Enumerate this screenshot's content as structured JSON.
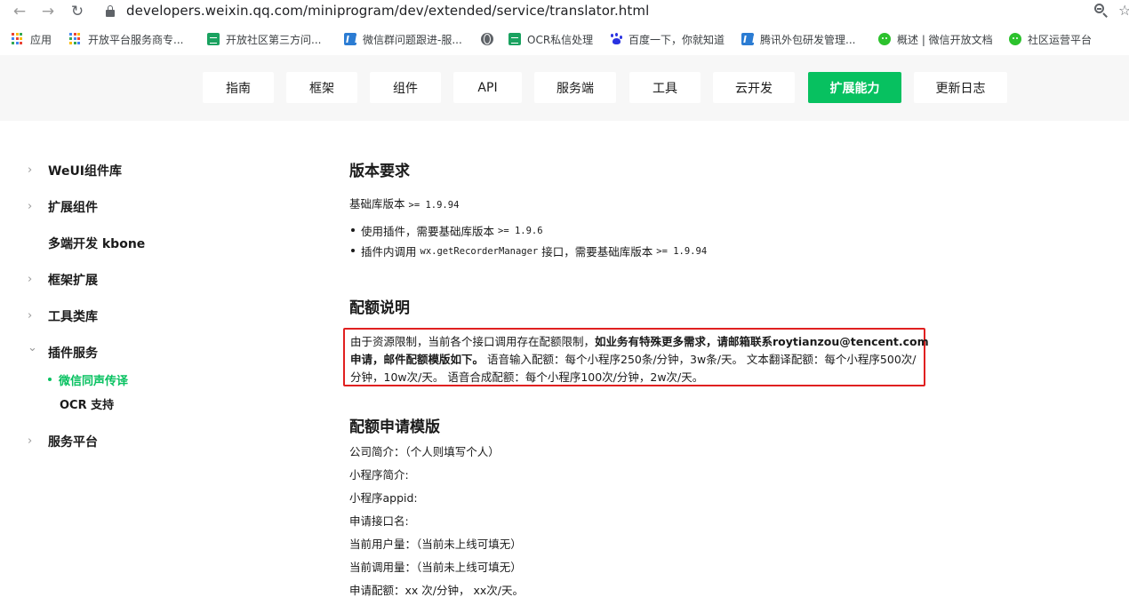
{
  "browser": {
    "url": "developers.weixin.qq.com/miniprogram/dev/extended/service/translator.html",
    "back_icon": "←",
    "forward_icon": "→",
    "reload_icon": "↻",
    "bookmarks": [
      {
        "label": "应用",
        "icon": "apps-icon"
      },
      {
        "label": "开放平台服务商专...",
        "icon": "apps-icon"
      },
      {
        "label": "开放社区第三方问...",
        "icon": "sheet-icon"
      },
      {
        "label": "微信群问题跟进-服...",
        "icon": "word-icon"
      },
      {
        "label": "",
        "icon": "globe-icon"
      },
      {
        "label": "OCR私信处理",
        "icon": "sheet-icon"
      },
      {
        "label": "百度一下，你就知道",
        "icon": "baidu-icon"
      },
      {
        "label": "腾讯外包研发管理...",
        "icon": "word-icon"
      },
      {
        "label": "概述 | 微信开放文档",
        "icon": "wechat-icon"
      },
      {
        "label": "社区运营平台",
        "icon": "wechat-icon"
      }
    ]
  },
  "topnav": {
    "tabs": [
      {
        "label": "指南",
        "active": false
      },
      {
        "label": "框架",
        "active": false
      },
      {
        "label": "组件",
        "active": false
      },
      {
        "label": "API",
        "active": false
      },
      {
        "label": "服务端",
        "active": false
      },
      {
        "label": "工具",
        "active": false
      },
      {
        "label": "云开发",
        "active": false
      },
      {
        "label": "扩展能力",
        "active": true
      },
      {
        "label": "更新日志",
        "active": false
      }
    ],
    "accent_color": "#07c160"
  },
  "sidebar": {
    "items": [
      {
        "label": "WeUI组件库",
        "chevron": "›"
      },
      {
        "label": "扩展组件",
        "chevron": "›"
      },
      {
        "label": "多端开发 kbone",
        "chevron": ""
      },
      {
        "label": "框架扩展",
        "chevron": "›"
      },
      {
        "label": "工具类库",
        "chevron": "›"
      },
      {
        "label": "插件服务",
        "chevron": "⌄"
      },
      {
        "label": "服务平台",
        "chevron": "›"
      }
    ],
    "sub_items": [
      {
        "label": "微信同声传译",
        "active": true
      },
      {
        "label": "OCR 支持",
        "active": false
      }
    ]
  },
  "content": {
    "version_heading": "版本要求",
    "base_lib_prefix": "基础库版本",
    "base_lib_version": ">= 1.9.94",
    "bullets": [
      {
        "text": "使用插件，需要基础库版本",
        "code": ">= 1.9.6"
      },
      {
        "text_before": "插件内调用",
        "code_api": "wx.getRecorderManager",
        "text_after": "接口，需要基础库版本",
        "code": ">= 1.9.94"
      }
    ],
    "quota_heading": "配额说明",
    "notice": {
      "line1_normal": "由于资源限制，当前各个接口调用存在配额限制，",
      "line1_bold": "如业务有特殊更多需求，请邮箱联系roytianzou@tencent.com",
      "line2_bold": "申请，邮件配额模版如下。",
      "line2_normal": " 语音输入配额：每个小程序250条/分钟，3w条/天。 文本翻译配额：每个小程序500次/",
      "line3_normal": "分钟，10w次/天。 语音合成配额：每个小程序100次/分钟，2w次/天。",
      "border_color": "#e02020"
    },
    "template_heading": "配额申请模版",
    "template_lines": [
      "公司简介：（个人则填写个人）",
      "小程序简介:",
      "小程序appid:",
      "申请接口名:",
      "当前用户量：（当前未上线可填无）",
      "当前调用量：（当前未上线可填无）",
      "申请配额：xx 次/分钟， xx次/天。"
    ]
  }
}
